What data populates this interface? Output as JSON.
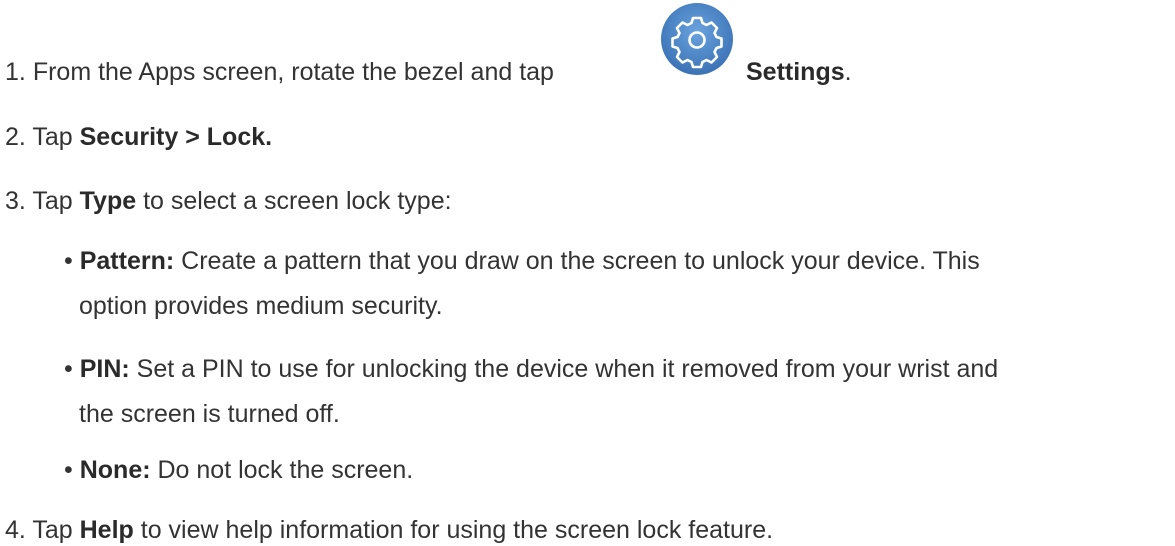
{
  "steps": [
    {
      "number": "1.",
      "text_before": "From the Apps screen, rotate the bezel and tap",
      "icon": "settings-gear-icon",
      "bold": "Settings",
      "text_after": "."
    },
    {
      "number": "2.",
      "text_before": "Tap",
      "bold": "Security > Lock."
    },
    {
      "number": "3.",
      "text_before": "Tap",
      "bold": "Type",
      "text_after": "to select a screen lock type:"
    },
    {
      "number": "4.",
      "text_before": "Tap",
      "bold": "Help",
      "text_after": "to view help information for using the screen lock feature."
    }
  ],
  "bullets": [
    {
      "marker": "•",
      "bold": "Pattern:",
      "line1": "Create a pattern that you draw on the screen to unlock your device. This",
      "line2": "option provides medium security."
    },
    {
      "marker": "•",
      "bold": "PIN:",
      "line1": "Set a PIN to use for unlocking the device when it removed from your wrist and",
      "line2": "the screen is turned off."
    },
    {
      "marker": "•",
      "bold": "None:",
      "line1": "Do not lock the screen."
    }
  ],
  "colors": {
    "icon_bg": "#4a86c8",
    "text": "#333333"
  }
}
